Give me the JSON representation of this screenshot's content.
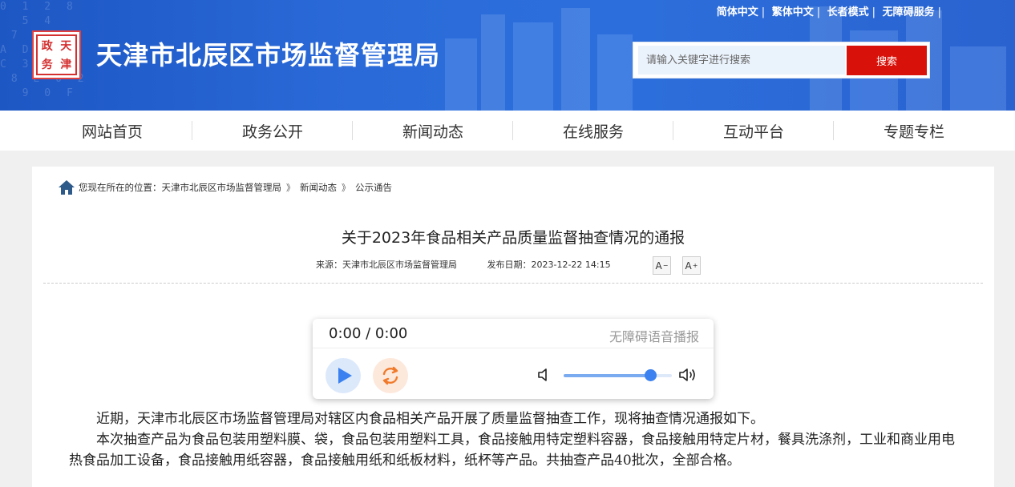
{
  "header": {
    "site_title": "天津市北辰区市场监督管理局",
    "seal_chars": [
      "天",
      "津",
      "政",
      "务"
    ],
    "top_links": [
      "简体中文",
      "繁体中文",
      "长者模式",
      "无障碍服务"
    ],
    "search": {
      "placeholder": "请输入关键字进行搜索",
      "button_label": "搜索"
    },
    "banner_bg_text": "0 1 2 8\n  5 4\n 7 6 3\nA D 1 B\nC 3 A 7\n 8 E 0 2\n  9 0 F"
  },
  "nav": {
    "items": [
      "网站首页",
      "政务公开",
      "新闻动态",
      "在线服务",
      "互动平台",
      "专题专栏"
    ]
  },
  "breadcrumb": {
    "prefix": "您现在所在的位置：",
    "items": [
      "天津市北辰区市场监督管理局",
      "新闻动态",
      "公示通告"
    ],
    "separator": "》"
  },
  "article": {
    "title": "关于2023年食品相关产品质量监督抽查情况的通报",
    "source": "来源：天津市北辰区市场监督管理局",
    "date": "发布日期：2023-12-22 14:15",
    "font_decrease": "A",
    "font_increase": "A",
    "paragraphs": [
      "近期，天津市北辰区市场监督管理局对辖区内食品相关产品开展了质量监督抽查工作，现将抽查情况通报如下。",
      "本次抽查产品为食品包装用塑料膜、袋，食品包装用塑料工具，食品接触用特定塑料容器，食品接触用特定片材，餐具洗涤剂，工业和商业用电热食品加工设备，食品接触用纸容器，食品接触用纸和纸板材料，纸杯等产品。共抽查产品40批次，全部合格。"
    ]
  },
  "player": {
    "time": "0:00 / 0:00",
    "label": "无障碍语音播报",
    "volume": 0.8,
    "accent_color": "#3b82f0"
  },
  "colors": {
    "banner": "#2a6ad8",
    "search_button": "#d8120a"
  }
}
